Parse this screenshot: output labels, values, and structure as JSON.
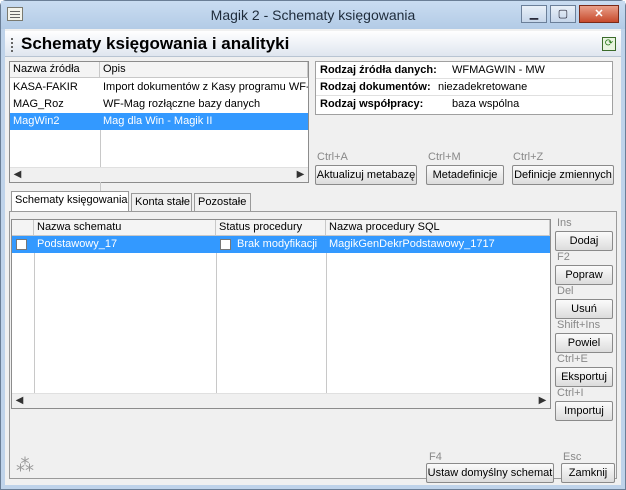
{
  "window": {
    "title": "Magik 2 - Schematy księgowania",
    "min_label": "▁",
    "max_label": "▢",
    "close_label": "✕"
  },
  "header": {
    "title": "Schematy księgowania i analityki"
  },
  "source_list": {
    "columns": [
      "Nazwa źródła",
      "Opis"
    ],
    "rows": [
      {
        "name": "KASA-FAKIR",
        "desc": "Import dokumentów z Kasy programu WF-Fa"
      },
      {
        "name": "MAG_Roz",
        "desc": "WF-Mag rozłączne bazy danych"
      },
      {
        "name": "MagWin2",
        "desc": "Mag dla Win - Magik II",
        "selected": true
      }
    ]
  },
  "info": {
    "rows": [
      {
        "label": "Rodzaj źródła danych:",
        "value": "WFMAGWIN - MW"
      },
      {
        "label": "Rodzaj dokumentów:",
        "value": "niezadekretowane"
      },
      {
        "label": "Rodzaj współpracy:",
        "value": "baza wspólna"
      }
    ]
  },
  "actions": {
    "update": {
      "shortcut": "Ctrl+A",
      "label": "Aktualizuj metabazę"
    },
    "metadef": {
      "shortcut": "Ctrl+M",
      "label": "Metadefinicje"
    },
    "vars": {
      "shortcut": "Ctrl+Z",
      "label": "Definicje zmiennych"
    }
  },
  "tabs": [
    {
      "label": "Schematy księgowania",
      "active": true
    },
    {
      "label": "Konta stałe"
    },
    {
      "label": "Pozostałe"
    }
  ],
  "grid": {
    "columns": [
      "Nazwa schematu",
      "Status procedury",
      "Nazwa procedury SQL"
    ],
    "rows": [
      {
        "name": "Podstawowy_17",
        "status": "Brak modyfikacji",
        "proc": "MagikGenDekrPodstawowy_1717",
        "selected": true
      }
    ]
  },
  "side_buttons": [
    {
      "shortcut": "Ins",
      "label": "Dodaj"
    },
    {
      "shortcut": "F2",
      "label": "Popraw"
    },
    {
      "shortcut": "Del",
      "label": "Usuń"
    },
    {
      "shortcut": "Shift+Ins",
      "label": "Powiel"
    },
    {
      "shortcut": "Ctrl+E",
      "label": "Eksportuj"
    },
    {
      "shortcut": "Ctrl+I",
      "label": "Importuj"
    }
  ],
  "footer": {
    "default_schema": {
      "shortcut": "F4",
      "label": "Ustaw domyślny schemat"
    },
    "close": {
      "shortcut": "Esc",
      "label": "Zamknij"
    }
  },
  "icons": {
    "app": "app-icon",
    "refresh": "refresh-icon",
    "status_cursor": "cursor-sparkle-icon"
  },
  "colors": {
    "selection": "#3399ff",
    "titlebar": "#bfd3ea"
  }
}
